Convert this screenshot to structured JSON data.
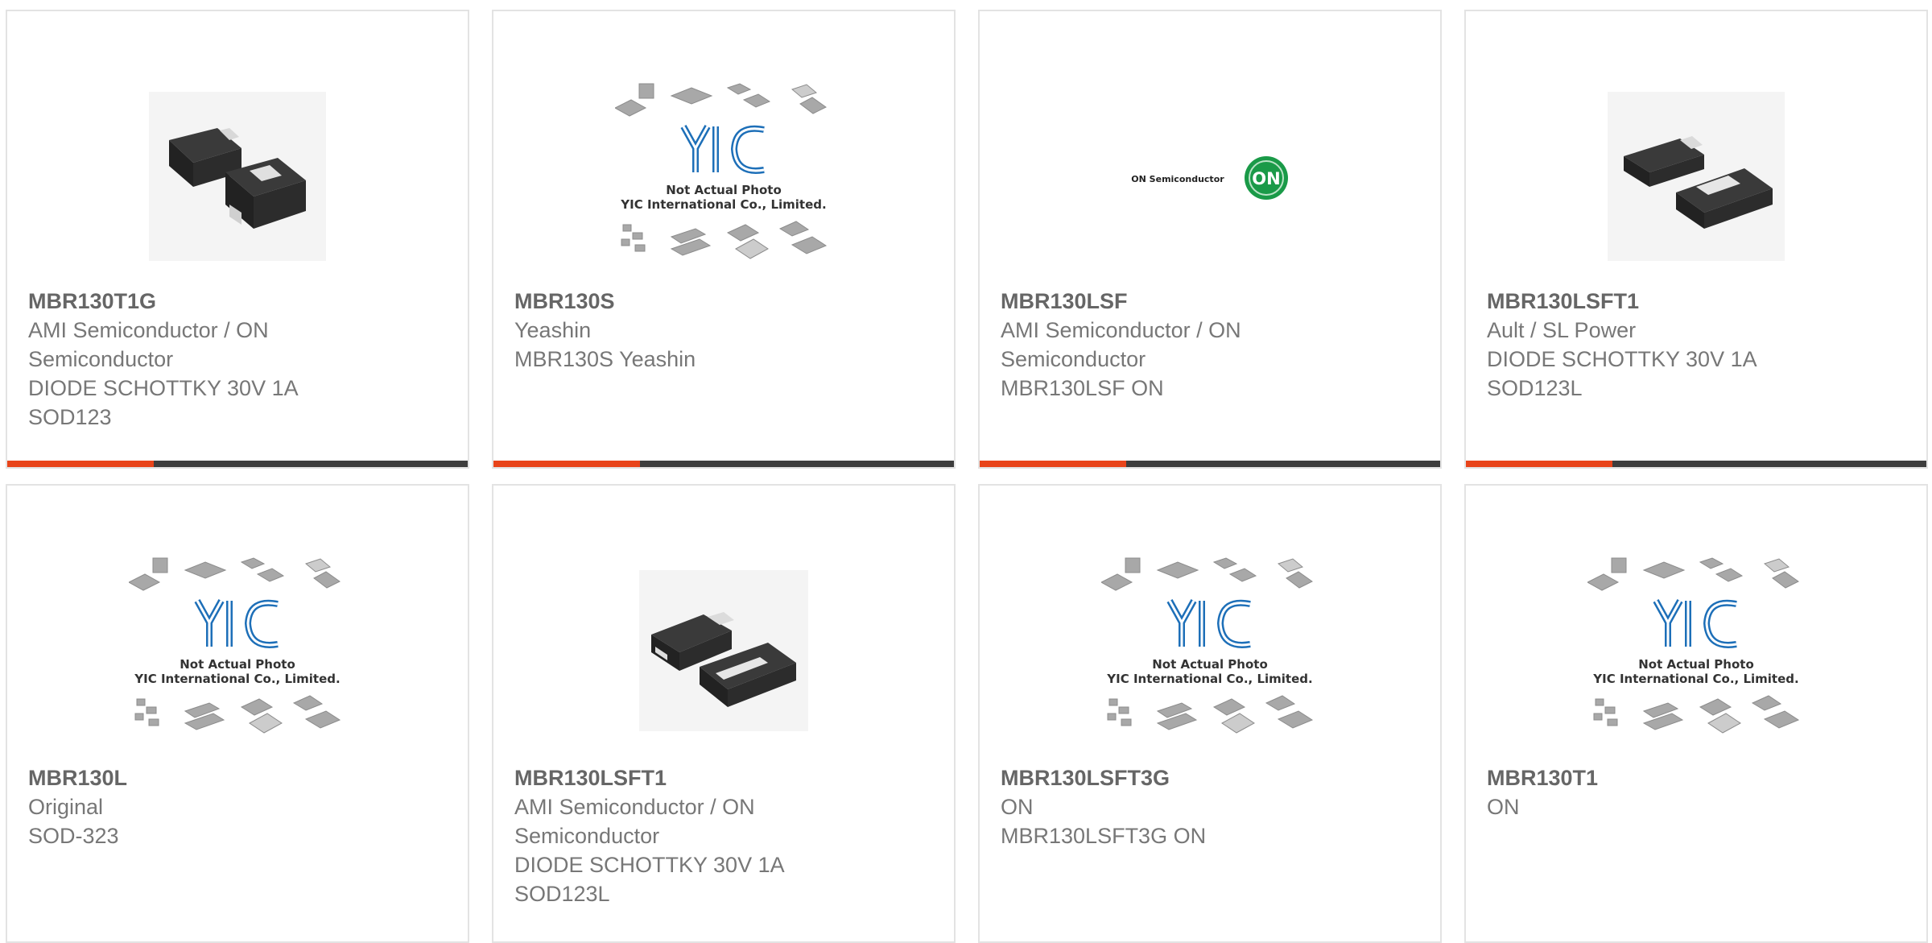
{
  "colors": {
    "accent": "#e8441a",
    "bar": "#3d3d3d",
    "text": "#777777",
    "title": "#666666",
    "yic_blue": "#1d6fb8",
    "on_green": "#1a9a48"
  },
  "cards": [
    {
      "part": "MBR130T1G",
      "lines": [
        "AMI Semiconductor / ON",
        "Semiconductor",
        "DIODE SCHOTTKY 30V 1A",
        "SOD123"
      ],
      "image": "diode-package-photo"
    },
    {
      "part": "MBR130S",
      "lines": [
        "Yeashin",
        "MBR130S Yeashin"
      ],
      "image": "yic-placeholder",
      "ph1": "Not Actual Photo",
      "ph2": "YIC International Co., Limited."
    },
    {
      "part": "MBR130LSF",
      "lines": [
        "AMI Semiconductor / ON",
        "Semiconductor",
        "MBR130LSF ON"
      ],
      "image": "on-semiconductor-logo",
      "logo_text": "ON Semiconductor",
      "logo_badge": "ON"
    },
    {
      "part": "MBR130LSFT1",
      "lines": [
        "Ault / SL Power",
        "DIODE SCHOTTKY 30V 1A",
        "SOD123L"
      ],
      "image": "diode-package-photo"
    },
    {
      "part": "MBR130L",
      "lines": [
        "Original",
        "SOD-323"
      ],
      "image": "yic-placeholder",
      "ph1": "Not Actual Photo",
      "ph2": "YIC International Co., Limited."
    },
    {
      "part": "MBR130LSFT1",
      "lines": [
        "AMI Semiconductor / ON",
        "Semiconductor",
        "DIODE SCHOTTKY 30V 1A",
        "SOD123L"
      ],
      "image": "diode-package-photo"
    },
    {
      "part": "MBR130LSFT3G",
      "lines": [
        "ON",
        "MBR130LSFT3G ON"
      ],
      "image": "yic-placeholder",
      "ph1": "Not Actual Photo",
      "ph2": "YIC International Co., Limited."
    },
    {
      "part": "MBR130T1",
      "lines": [
        "ON"
      ],
      "image": "yic-placeholder",
      "ph1": "Not Actual Photo",
      "ph2": "YIC International Co., Limited."
    }
  ]
}
